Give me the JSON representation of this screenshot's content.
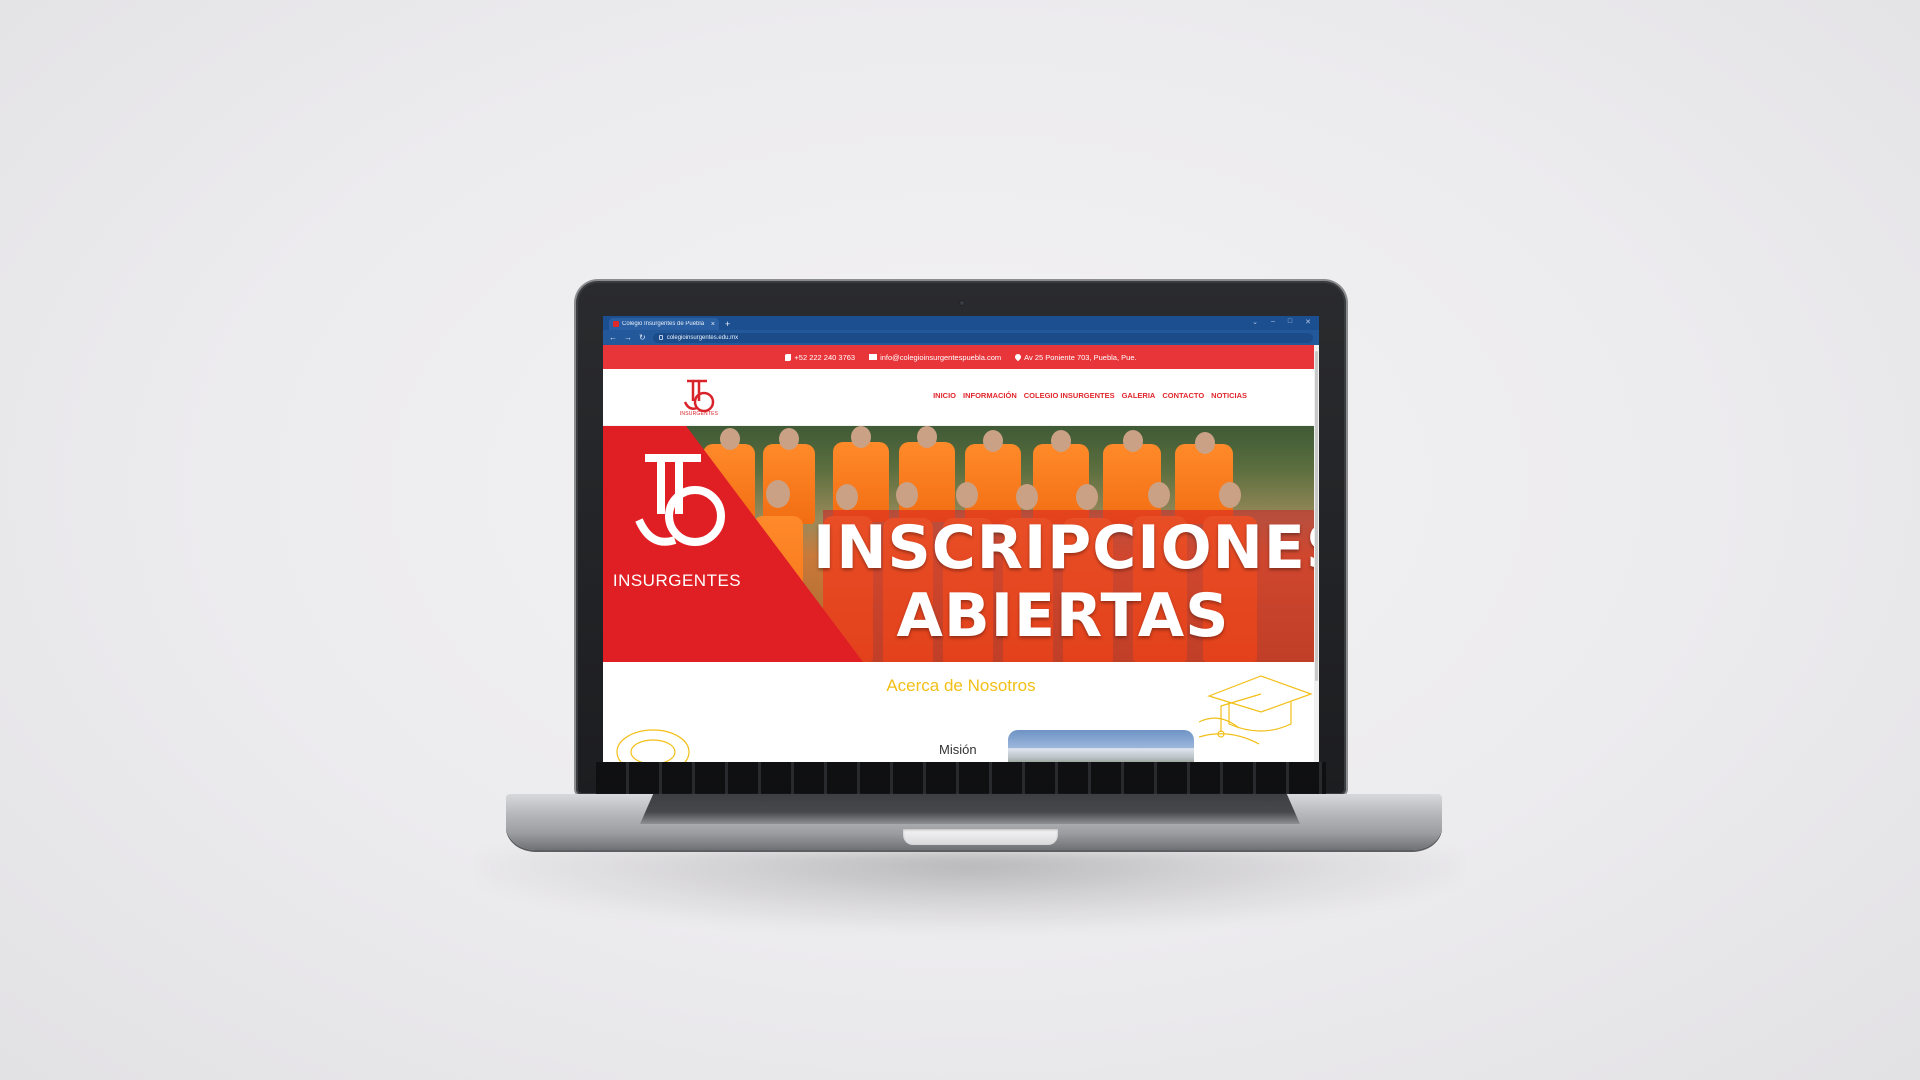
{
  "browser": {
    "tab_title": "Colegio Insurgentes de Puebla",
    "tab_close": "×",
    "new_tab": "+",
    "url": "colegioinsurgentes.edu.mx",
    "back": "←",
    "forward": "→",
    "reload": "↻",
    "window_controls": [
      "⌄",
      "–",
      "□",
      "✕"
    ]
  },
  "topbar": {
    "phone": "+52 222 240 3763",
    "email": "info@colegioinsurgentespuebla.com",
    "address": "Av 25 Poniente 703, Puebla, Pue."
  },
  "navbar": {
    "logo_text": "INSURGENTES",
    "links": [
      "INICIO",
      "INFORMACIÓN",
      "COLEGIO INSURGENTES",
      "GALERIA",
      "CONTACTO",
      "NOTICIAS"
    ]
  },
  "hero": {
    "logo_text": "INSURGENTES",
    "title_line1": "INSCRIPCIONES",
    "title_line2": "ABIERTAS"
  },
  "about": {
    "title": "Acerca de Nosotros",
    "mision": "Misión"
  },
  "colors": {
    "brand_red": "#e8353a",
    "accent_yellow": "#f2bf17",
    "browser_blue": "#1b4f8f"
  }
}
